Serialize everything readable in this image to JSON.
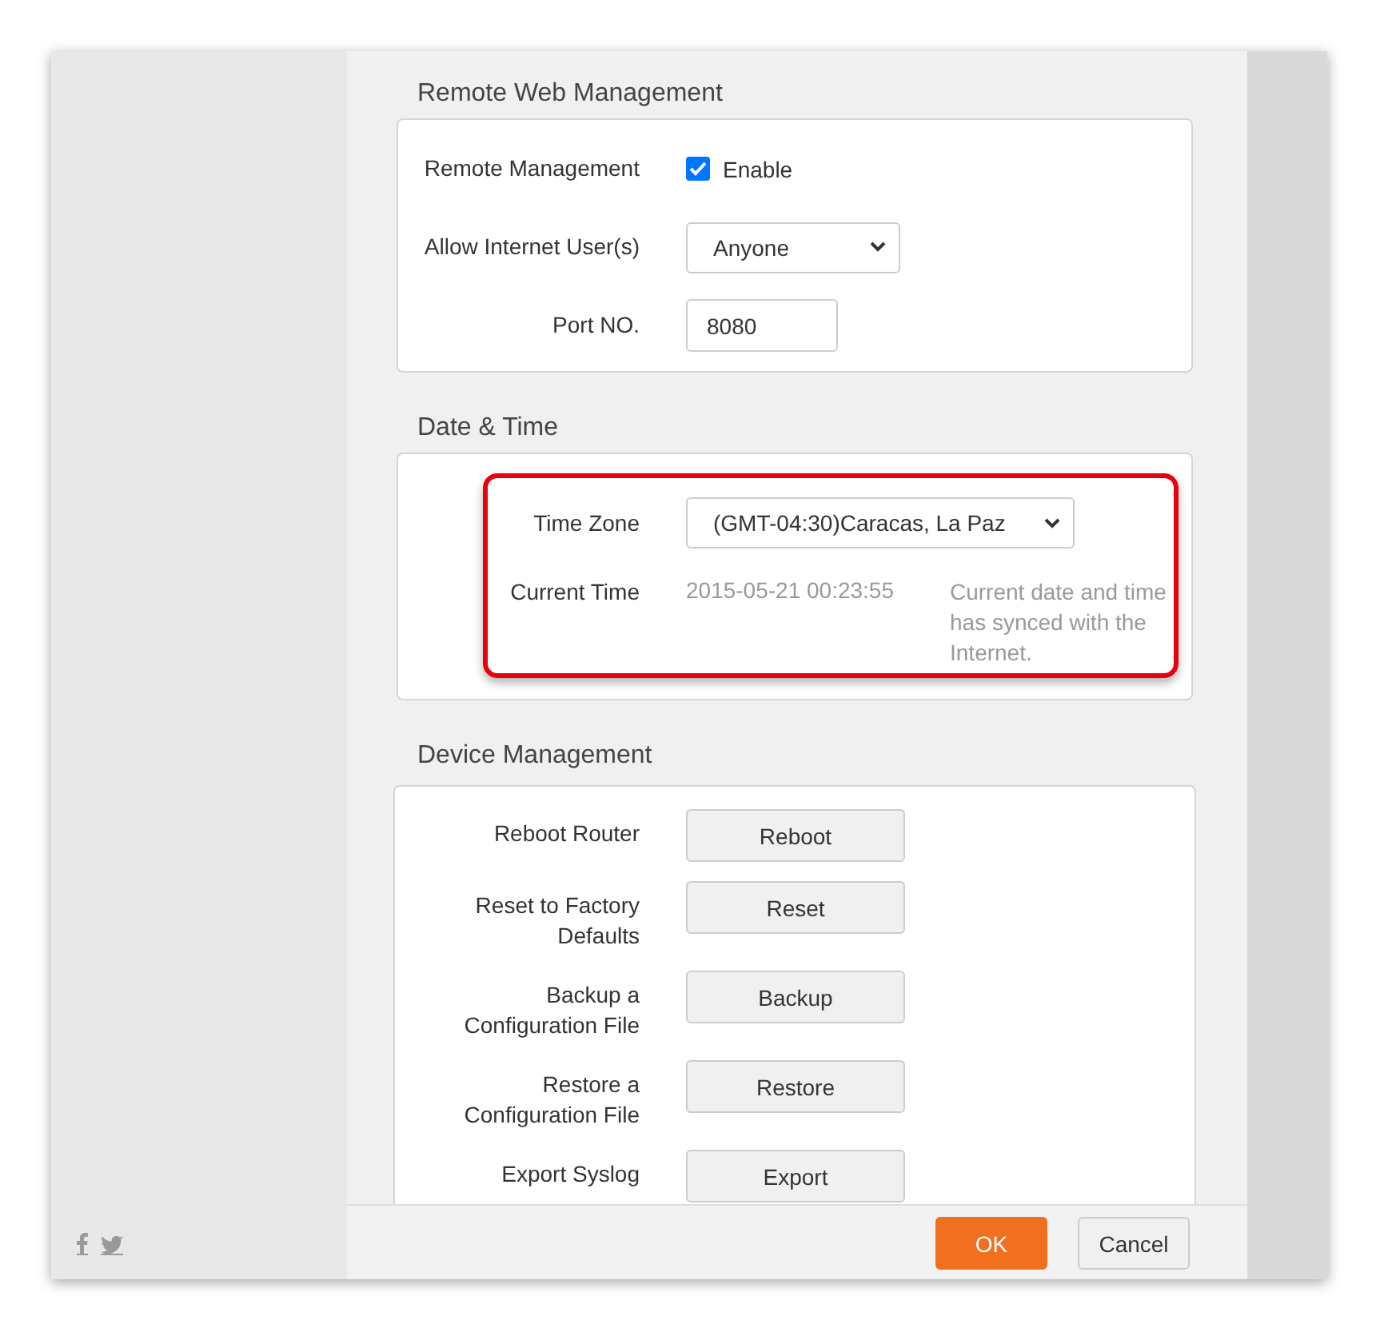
{
  "sections": [
    {
      "title": "Remote Web Management",
      "highlighted": false,
      "rows": [
        {
          "kind": "checkbox",
          "label": "Remote Management",
          "checked": true,
          "text": "Enable"
        },
        {
          "kind": "select",
          "label": "Allow Internet User(s)",
          "value": "Anyone"
        },
        {
          "kind": "input",
          "label": "Port NO.",
          "value": "8080"
        }
      ]
    },
    {
      "title": "Date & Time",
      "highlighted": true,
      "rows": [
        {
          "kind": "select",
          "label": "Time Zone",
          "value": "(GMT-04:30)Caracas, La Paz"
        },
        {
          "kind": "text",
          "label": "Current Time",
          "value": "2015-05-21 00:23:55",
          "note": "Current date and time has synced with the Internet."
        }
      ]
    },
    {
      "title": "Device Management",
      "highlighted": false,
      "rows": [
        {
          "kind": "button",
          "label": "Reboot Router",
          "button": "Reboot"
        },
        {
          "kind": "button",
          "label": "Reset to Factory Defaults",
          "button": "Reset"
        },
        {
          "kind": "button",
          "label": "Backup a Configuration File",
          "button": "Backup"
        },
        {
          "kind": "button",
          "label": "Restore a Configuration File",
          "button": "Restore"
        },
        {
          "kind": "button",
          "label": "Export Syslog",
          "button": "Export"
        }
      ]
    }
  ],
  "footer": {
    "ok": "OK",
    "cancel": "Cancel"
  }
}
